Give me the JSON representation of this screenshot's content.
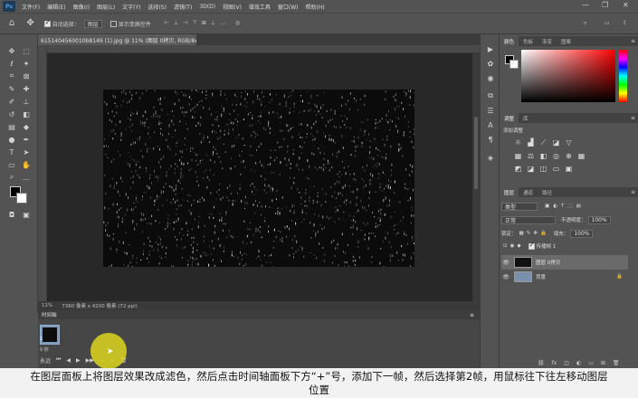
{
  "menubar": {
    "logo": "Ps",
    "items": [
      "文件(F)",
      "编辑(E)",
      "图像(I)",
      "图层(L)",
      "文字(Y)",
      "选择(S)",
      "滤镜(T)",
      "3D(D)",
      "视图(V)",
      "增效工具",
      "窗口(W)",
      "帮助(H)"
    ],
    "min": "—",
    "max": "❐",
    "close": "✕"
  },
  "optbar": {
    "home_icon": "home-icon",
    "auto_select_label": "自动选择：",
    "auto_select_value": "图层",
    "show_transform_label": "显示变换控件"
  },
  "document": {
    "tab_title": "6151404560010b8149 (1).jpg @ 11% (图层 0拷贝, RGB/8#) *",
    "status_zoom": "11%",
    "status_info": "7360 像素 x 4200 像素 (72 ppi)"
  },
  "timeline": {
    "title": "时间轴",
    "frame_label": "1",
    "frame_time": "0 秒",
    "loop_label": "永远"
  },
  "panels": {
    "color_tabs": [
      "颜色",
      "色板",
      "渐变",
      "图案"
    ],
    "adjust_tabs": [
      "调整",
      "库"
    ],
    "adjust_label": "添加调整",
    "layers_tabs": [
      "图层",
      "通道",
      "路径"
    ],
    "kind_label": "类型",
    "blend_mode": "正常",
    "opacity_label": "不透明度：",
    "opacity_value": "100%",
    "lock_label": "锁定：",
    "fill_label": "填充：",
    "fill_value": "100%",
    "propagate_label": "传播帧 1",
    "layers": [
      {
        "name": "图层 0拷贝"
      },
      {
        "name": "背景"
      }
    ]
  },
  "caption": {
    "line1": "在图层面板上将图层效果改成滤色，然后点击时间轴面板下方“+”号，添加下一帧，然后选择第2帧，用鼠标往下往左移动图层",
    "line2": "位置"
  },
  "colors": {
    "accent": "#7f9bbb",
    "cursor_highlight": "#ded61e"
  }
}
